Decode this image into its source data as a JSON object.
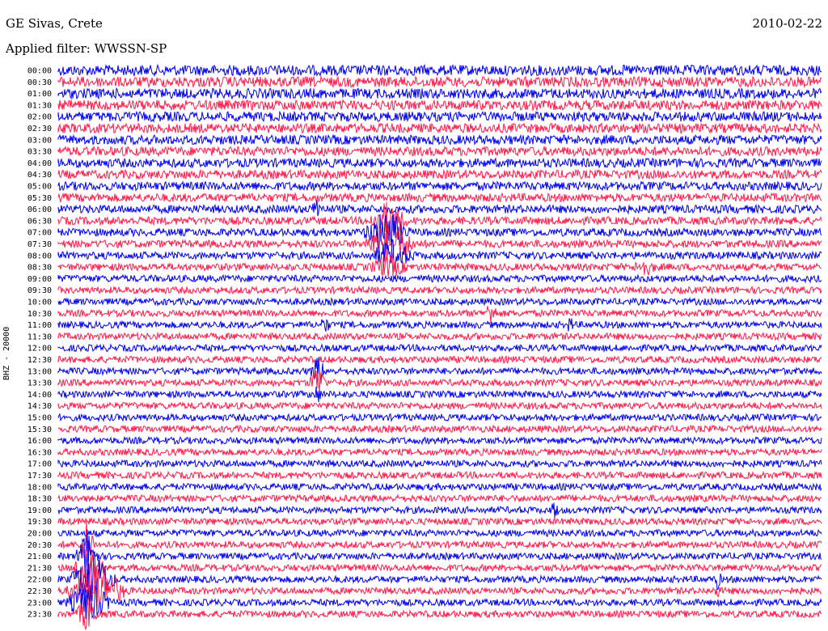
{
  "header": {
    "station": "GE Sivas, Crete",
    "date": "2010-02-22",
    "filter_label": "Applied filter:",
    "filter_value": "WWSSN-SP"
  },
  "chart_data": {
    "type": "line",
    "title": "GE Sivas, Crete",
    "ylabel": "BHZ - 20000",
    "trace_colors": [
      "#0000ee",
      "#ff1a4b"
    ],
    "row_labels": [
      "00:00",
      "00:30",
      "01:00",
      "01:30",
      "02:00",
      "02:30",
      "03:00",
      "03:30",
      "04:00",
      "04:30",
      "05:00",
      "05:30",
      "06:00",
      "06:30",
      "07:00",
      "07:30",
      "08:00",
      "08:30",
      "09:00",
      "09:30",
      "10:00",
      "10:30",
      "11:00",
      "11:30",
      "12:00",
      "12:30",
      "13:00",
      "13:30",
      "14:00",
      "14:30",
      "15:00",
      "15:30",
      "16:00",
      "16:30",
      "17:00",
      "17:30",
      "18:00",
      "18:30",
      "19:00",
      "19:30",
      "20:00",
      "20:30",
      "21:00",
      "21:30",
      "22:00",
      "22:30",
      "23:00",
      "23:30"
    ]
  }
}
